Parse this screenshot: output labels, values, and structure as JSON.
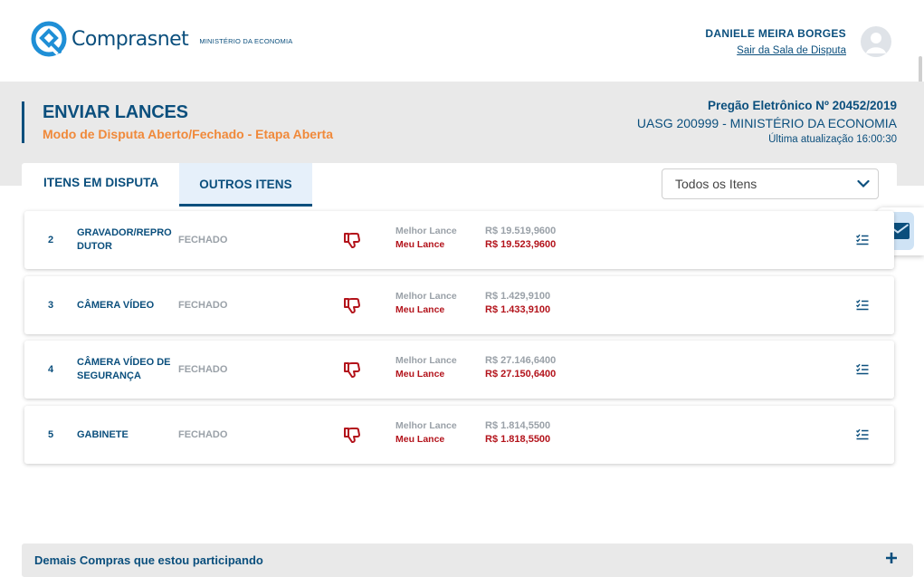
{
  "header": {
    "brand": "Comprasnet",
    "brand_sub": "MINISTÉRIO DA ECONOMIA",
    "user_name": "DANIELE MEIRA BORGES",
    "user_link": "Sair da Sala de Disputa",
    "avatar_icon": "user-avatar-icon"
  },
  "page": {
    "title": "ENVIAR LANCES",
    "subtitle": "Modo de Disputa Aberto/Fechado - Etapa Aberta",
    "pregao": "Pregão Eletrônico Nº 20452/2019",
    "uasg": "UASG 200999 - MINISTÉRIO DA ECONOMIA",
    "updated": "Última atualização 16:00:30"
  },
  "tabs": [
    {
      "label": "ITENS EM DISPUTA",
      "active": false
    },
    {
      "label": "OUTROS ITENS",
      "active": true
    }
  ],
  "filter": {
    "selected": "Todos os Itens"
  },
  "labels": {
    "best": "Melhor Lance",
    "mine": "Meu Lance"
  },
  "items": [
    {
      "num": "2",
      "name": "GRAVADOR/REPRODUTOR",
      "status": "FECHADO",
      "best_bid": "R$ 19.519,9600",
      "my_bid": "R$ 19.523,9600"
    },
    {
      "num": "3",
      "name": "CÂMERA VÍDEO",
      "status": "FECHADO",
      "best_bid": "R$ 1.429,9100",
      "my_bid": "R$ 1.433,9100"
    },
    {
      "num": "4",
      "name": "CÂMERA VÍDEO DE SEGURANÇA",
      "status": "FECHADO",
      "best_bid": "R$ 27.146,6400",
      "my_bid": "R$ 27.150,6400"
    },
    {
      "num": "5",
      "name": "GABINETE",
      "status": "FECHADO",
      "best_bid": "R$ 1.814,5500",
      "my_bid": "R$ 1.818,5500"
    }
  ],
  "footer": {
    "label": "Demais Compras que estou participando"
  },
  "colors": {
    "primary": "#0b4f7d",
    "accent_orange": "#f0893a",
    "losing_red": "#b3131b",
    "muted_gray": "#9aa1a8",
    "band_gray": "#e9e9e9"
  },
  "icons": {
    "thumb": "thumbs-down-icon",
    "detail": "list-check-icon",
    "mail": "envelope-icon",
    "expand": "plus-icon",
    "dropdown": "chevron-down-icon"
  }
}
